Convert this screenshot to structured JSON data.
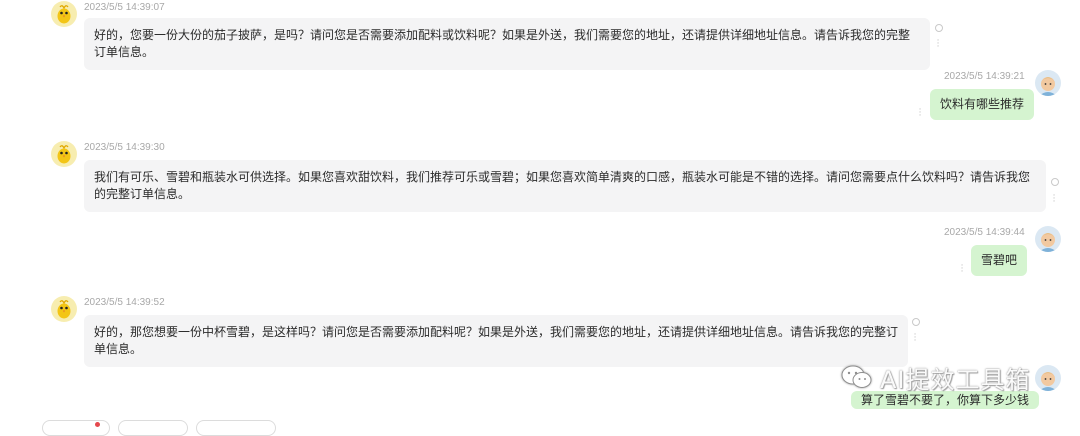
{
  "messages": [
    {
      "role": "assistant",
      "timestamp": "2023/5/5 14:39:07",
      "text": "好的，您要一份大份的茄子披萨，是吗？请问您是否需要添加配料或饮料呢？如果是外送，我们需要您的地址，还请提供详细地址信息。请告诉我您的完整订单信息。"
    },
    {
      "role": "user",
      "timestamp": "2023/5/5 14:39:21",
      "text": "饮料有哪些推荐"
    },
    {
      "role": "assistant",
      "timestamp": "2023/5/5 14:39:30",
      "text": "我们有可乐、雪碧和瓶装水可供选择。如果您喜欢甜饮料，我们推荐可乐或雪碧；如果您喜欢简单清爽的口感，瓶装水可能是不错的选择。请问您需要点什么饮料吗？请告诉我您的完整订单信息。"
    },
    {
      "role": "user",
      "timestamp": "2023/5/5 14:39:44",
      "text": "雪碧吧"
    },
    {
      "role": "assistant",
      "timestamp": "2023/5/5 14:39:52",
      "text": "好的，那您想要一份中杯雪碧，是这样吗？请问您是否需要添加配料呢？如果是外送，我们需要您的地址，还请提供详细地址信息。请告诉我您的完整订单信息。"
    },
    {
      "role": "user",
      "timestamp": "",
      "text": "算了雪碧不要了，你算下多少钱"
    }
  ],
  "watermark": {
    "icon": "wechat-icon",
    "text": "AI提效工具箱"
  },
  "colors": {
    "assistant_bubble": "#f4f4f5",
    "user_bubble": "#d5f4d0",
    "timestamp": "#a8a8a8"
  }
}
